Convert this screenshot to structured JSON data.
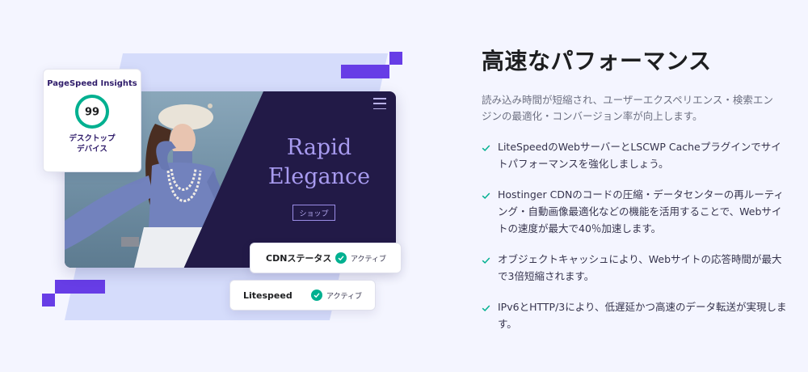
{
  "pagespeed": {
    "title": "PageSpeed Insights",
    "score": "99",
    "device_line1": "デスクトップ",
    "device_line2": "デバイス"
  },
  "hero": {
    "title_line1": "Rapid",
    "title_line2": "Elegance",
    "shop_button": "ショップ"
  },
  "status_cards": [
    {
      "name": "CDNステータス",
      "status": "アクティブ"
    },
    {
      "name": "Litespeed",
      "status": "アクティブ"
    }
  ],
  "section": {
    "heading": "高速なパフォーマンス",
    "lead": "読み込み時間が短縮され、ユーザーエクスペリエンス・検索エンジンの最適化・コンバージョン率が向上します。",
    "features": [
      "LiteSpeedのWebサーバーとLSCWP Cacheプラグインでサイトパフォーマンスを強化しましょう。",
      "Hostinger CDNのコードの圧縮・データセンターの再ルーティング・自動画像最適化などの機能を活用することで、Webサイトの速度が最大で40％加速します。",
      "オブジェクトキャッシュにより、Webサイトの応答時間が最大で3倍短縮されます。",
      "IPv6とHTTP/3により、低遅延かつ高速のデータ転送が実現します。"
    ]
  },
  "colors": {
    "accent_purple": "#673de6",
    "success_green": "#00b090",
    "background": "#f4f5ff",
    "hero_background": "#221a47"
  },
  "icons": [
    "menu-icon",
    "check-icon"
  ]
}
